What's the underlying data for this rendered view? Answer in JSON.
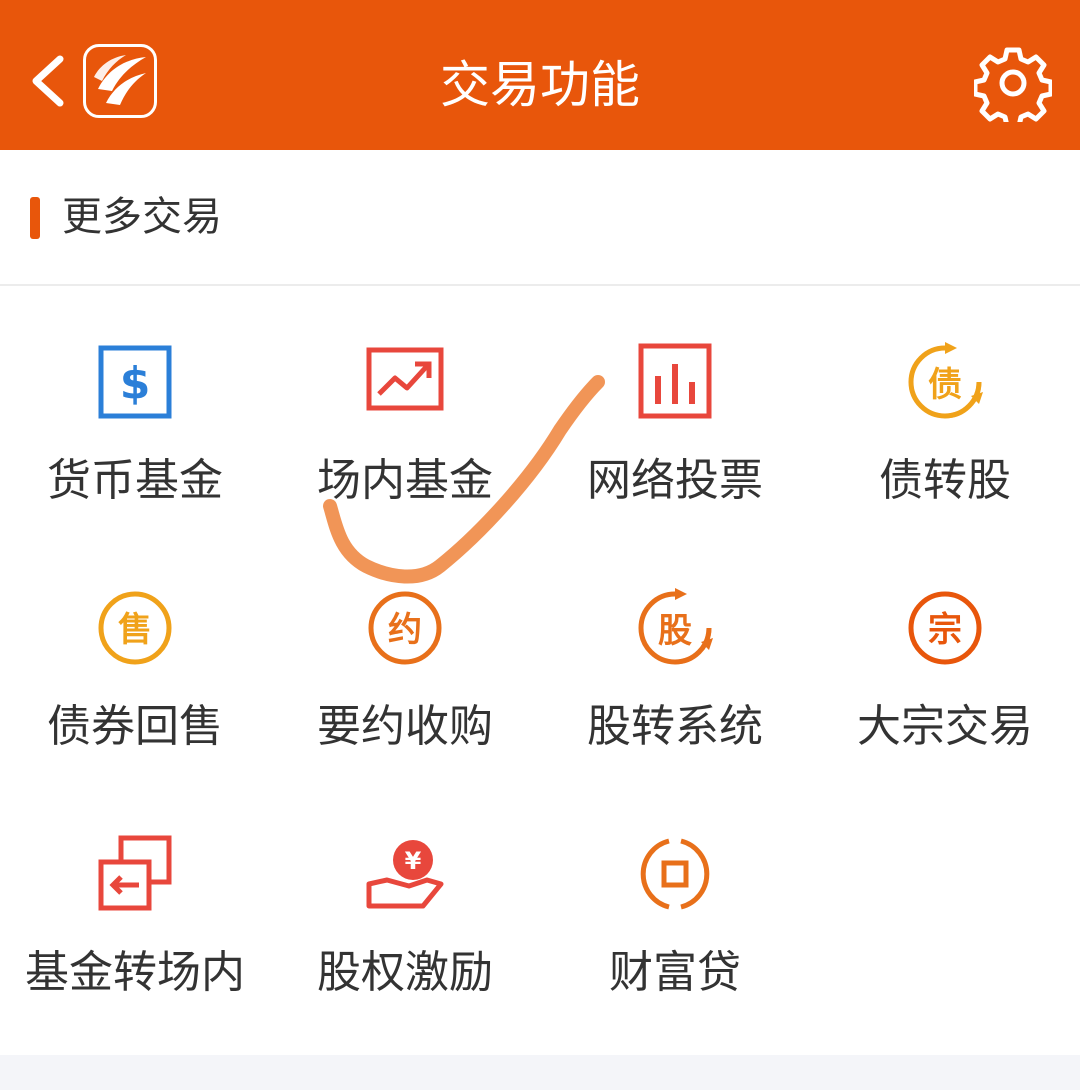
{
  "header": {
    "title": "交易功能",
    "back_icon": "chevron-left-icon",
    "logo_icon": "brokerage-logo-icon",
    "settings_icon": "gear-icon",
    "background_color": "#e8560b"
  },
  "section": {
    "title": "更多交易",
    "accent_color": "#e8560b"
  },
  "functions": [
    {
      "label": "货币基金",
      "icon": "dollar-box-icon",
      "color": "#2b7fd8"
    },
    {
      "label": "场内基金",
      "icon": "trend-chart-icon",
      "color": "#e8473c"
    },
    {
      "label": "网络投票",
      "icon": "bar-chart-icon",
      "color": "#e8473c"
    },
    {
      "label": "债转股",
      "icon": "bond-convert-icon",
      "glyph": "债",
      "color": "#f0a21a"
    },
    {
      "label": "债券回售",
      "icon": "sell-circle-icon",
      "glyph": "售",
      "color": "#f0a21a"
    },
    {
      "label": "要约收购",
      "icon": "offer-circle-icon",
      "glyph": "约",
      "color": "#e8701a"
    },
    {
      "label": "股转系统",
      "icon": "stock-transfer-icon",
      "glyph": "股",
      "color": "#e8701a"
    },
    {
      "label": "大宗交易",
      "icon": "block-trade-icon",
      "glyph": "宗",
      "color": "#e8560b"
    },
    {
      "label": "基金转场内",
      "icon": "transfer-boxes-icon",
      "color": "#e8473c"
    },
    {
      "label": "股权激励",
      "icon": "yen-hand-icon",
      "glyph": "¥",
      "color": "#e8473c"
    },
    {
      "label": "财富贷",
      "icon": "coin-loan-icon",
      "color": "#e8701a"
    }
  ],
  "annotation": {
    "icon": "handwritten-checkmark-icon",
    "color": "#f08a45"
  }
}
